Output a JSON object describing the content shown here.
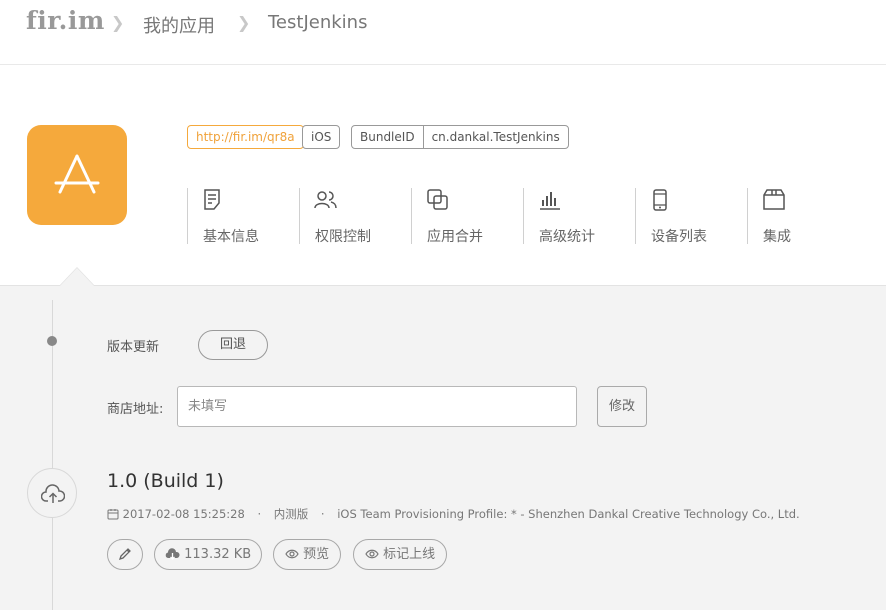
{
  "header": {
    "logo": "fir.im",
    "breadcrumb": [
      "我的应用",
      "TestJenkins"
    ]
  },
  "app": {
    "icon": "app-store-icon",
    "icon_color": "#f5a93c",
    "short_link": "http://fir.im/qr8a",
    "platform": "iOS",
    "bundle_label": "BundleID",
    "bundle_id": "cn.dankal.TestJenkins"
  },
  "tabs": [
    {
      "label": "基本信息",
      "icon": "document-icon"
    },
    {
      "label": "权限控制",
      "icon": "users-icon"
    },
    {
      "label": "应用合并",
      "icon": "merge-icon"
    },
    {
      "label": "高级统计",
      "icon": "bar-chart-icon"
    },
    {
      "label": "设备列表",
      "icon": "phone-icon"
    },
    {
      "label": "集成",
      "icon": "box-icon"
    }
  ],
  "update": {
    "label": "版本更新",
    "rollback_label": "回退",
    "store_label": "商店地址:",
    "store_value": "",
    "store_placeholder": "未填写",
    "edit_label": "修改"
  },
  "build": {
    "version": "1.0 (Build 1)",
    "date": "2017-02-08 15:25:28",
    "type": "内测版",
    "profile": "iOS Team Provisioning Profile: * - Shenzhen Dankal Creative Technology Co., Ltd.",
    "size": "113.32 KB",
    "preview_label": "预览",
    "mark_label": "标记上线"
  },
  "colors": {
    "accent": "#f5a93c",
    "background": "#f3f3f3"
  }
}
